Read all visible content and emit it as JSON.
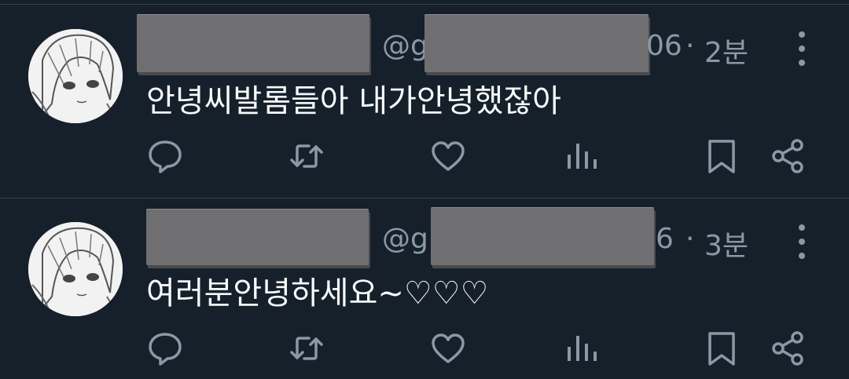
{
  "tweets": [
    {
      "handle_prefix": "@g",
      "date_tail": "06",
      "separator": "·",
      "time_ago": "2분",
      "text": "안녕씨발롬들아 내가안녕했잖아"
    },
    {
      "handle_prefix": "@g",
      "date_tail": "6",
      "separator": "·",
      "time_ago": "3분",
      "text": "여러분안녕하세요~♡♡♡"
    }
  ],
  "icons": [
    "reply-icon",
    "retweet-icon",
    "like-icon",
    "views-icon",
    "bookmark-icon",
    "share-icon",
    "more-icon"
  ],
  "colors": {
    "background": "#15202b",
    "text": "#f7f9f9",
    "secondary": "#8b98a5",
    "divider": "#38444d"
  }
}
